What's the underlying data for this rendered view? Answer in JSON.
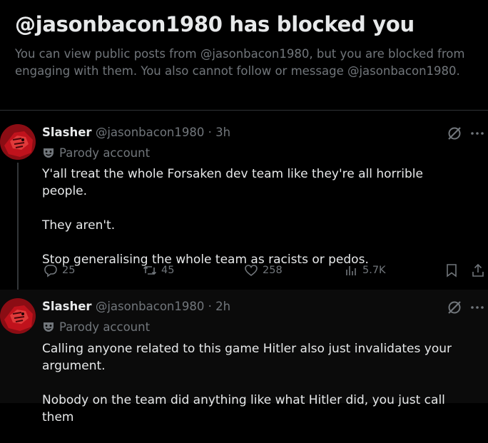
{
  "banner": {
    "title": "@jasonbacon1980 has blocked you",
    "message": "You can view public posts from @jasonbacon1980, but you are blocked from engaging with them. You also cannot follow or message @jasonbacon1980."
  },
  "colors": {
    "background": "#000000",
    "text_primary": "#e7e9ea",
    "text_secondary": "#71767b",
    "avatar_red": "#c0121c"
  },
  "icons": {
    "parody": "theater-mask-icon",
    "grok": "grok-icon",
    "more": "more-options-icon",
    "reply": "reply-icon",
    "retweet": "retweet-icon",
    "like": "heart-icon",
    "views": "views-chart-icon",
    "bookmark": "bookmark-icon",
    "share": "share-icon"
  },
  "tweets": [
    {
      "display_name": "Slasher",
      "handle": "@jasonbacon1980",
      "separator": "·",
      "time": "3h",
      "label": "Parody account",
      "paragraphs": [
        "Y'all treat the whole Forsaken dev team like they're all horrible people.",
        "They aren't.",
        "Stop generalising the whole team as racists or pedos."
      ],
      "stats": {
        "replies": "25",
        "retweets": "45",
        "likes": "258",
        "views": "5.7K"
      }
    },
    {
      "display_name": "Slasher",
      "handle": "@jasonbacon1980",
      "separator": "·",
      "time": "2h",
      "label": "Parody account",
      "paragraphs": [
        "Calling anyone related to this game Hitler also just invalidates your argument.",
        "Nobody on the team did anything like what Hitler did, you just call them"
      ]
    }
  ]
}
